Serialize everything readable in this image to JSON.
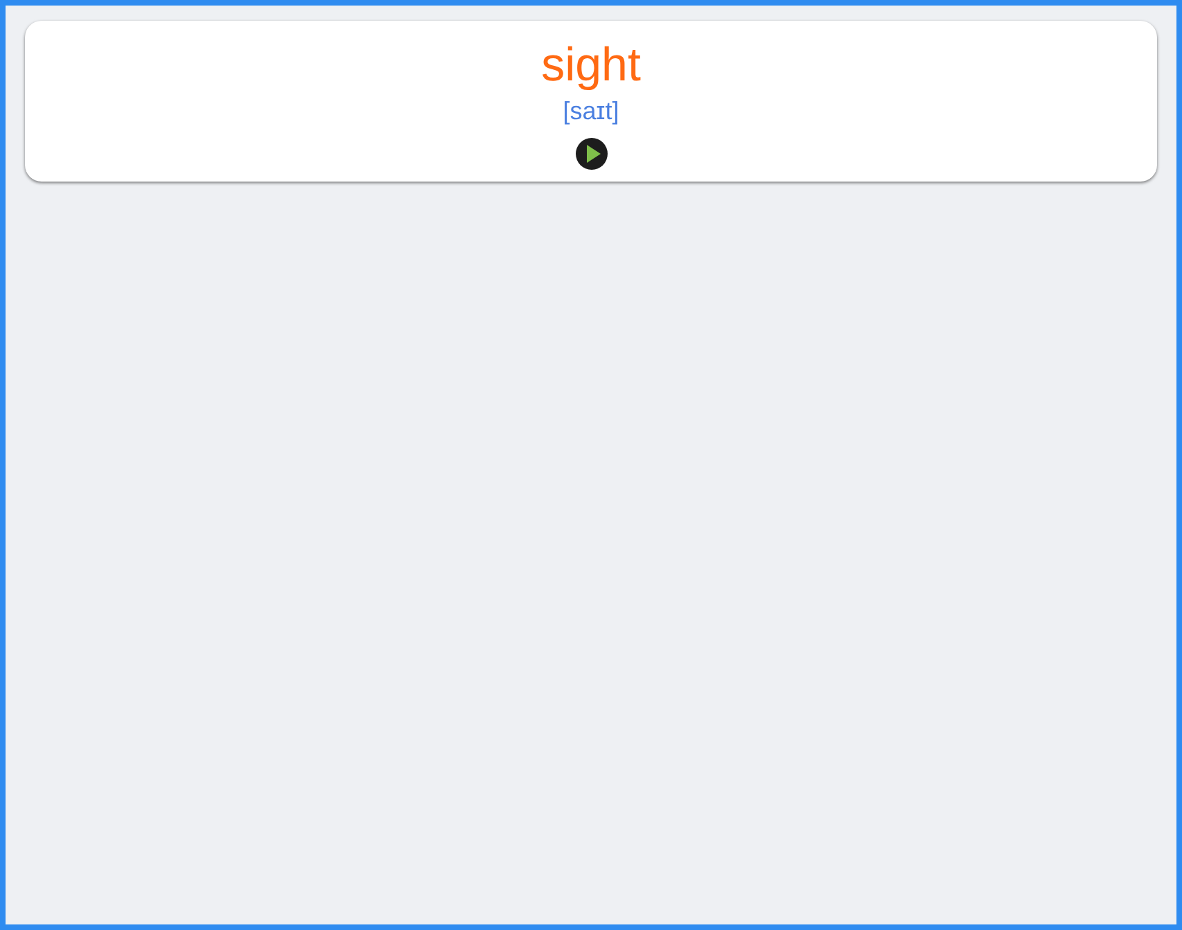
{
  "word": "sight",
  "transcription": "[saɪt]"
}
